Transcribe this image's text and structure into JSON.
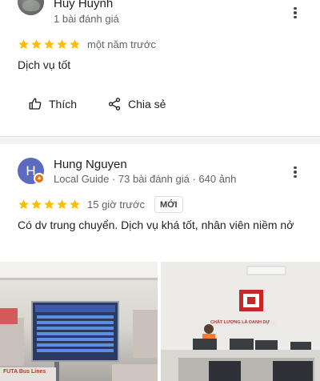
{
  "reviews": [
    {
      "reviewer_name": "Huy Huỳnh",
      "reviewer_meta": "1 bài đánh giá",
      "rating": 5,
      "time": "một năm trước",
      "text": "Dịch vụ tốt",
      "actions": {
        "like_label": "Thích",
        "share_label": "Chia sẻ"
      }
    },
    {
      "avatar_letter": "H",
      "reviewer_name": "Hung Nguyen",
      "reviewer_meta": "Local Guide · 73 bài đánh giá · 640 ảnh",
      "rating": 5,
      "time": "15 giờ trước",
      "badge": "MỚI",
      "text": "Có dv trung chuyển. Dịch vụ khá tốt, nhân viên niềm nở"
    }
  ],
  "photos": {
    "photo_1": {
      "sign_text": "FUTA Bus Lines"
    },
    "photo_2": {
      "sign_text": "CHẤT LƯỢNG LÀ DANH DỰ"
    }
  },
  "colors": {
    "star": "#fbbc04",
    "avatar_bg": "#5c6bc0",
    "local_guide_badge": "#e8710a"
  },
  "icons": {
    "more": "more-vert-icon",
    "like": "thumb-up-icon",
    "share": "share-icon",
    "star": "star-icon"
  }
}
